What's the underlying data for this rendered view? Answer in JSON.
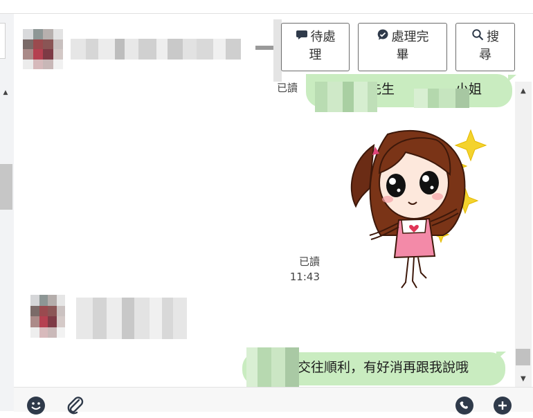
{
  "header": {
    "contact_name": "",
    "buttons": {
      "pending": {
        "line1": "待處",
        "line2": "理",
        "icon": "speech-bubble-icon"
      },
      "done": {
        "line1": "處理完",
        "line2": "畢",
        "icon": "check-bubble-icon"
      },
      "search": {
        "line1": "搜",
        "line2": "尋",
        "icon": "magnifier-icon"
      }
    }
  },
  "messages": [
    {
      "direction": "outgoing",
      "type": "text",
      "parts": [
        "先生",
        "小姐"
      ],
      "read_label": "已讀"
    },
    {
      "direction": "outgoing",
      "type": "sticker",
      "sticker_name": "girl-with-sparkles-sticker",
      "read_label": "已讀",
      "time": "11:43"
    },
    {
      "direction": "incoming",
      "type": "profile",
      "sender_name": ""
    },
    {
      "direction": "outgoing",
      "type": "text",
      "text": "交往順利，有好消再跟我說哦"
    }
  ],
  "input_bar": {
    "icons": [
      "emoji-icon",
      "paperclip-icon",
      "phone-icon",
      "plus-icon"
    ]
  },
  "colors": {
    "outgoing_bubble": "#c9ecc0",
    "header_button_border": "#6b6b6b",
    "icon_dark": "#2f3a4a"
  }
}
